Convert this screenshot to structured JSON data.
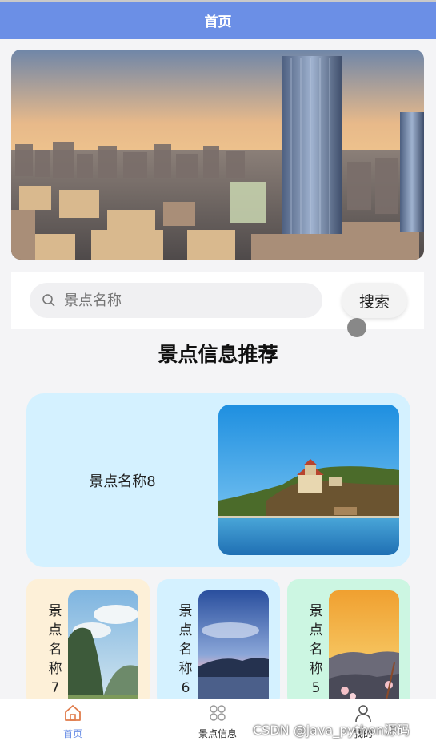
{
  "header": {
    "title": "首页"
  },
  "search": {
    "placeholder": "景点名称",
    "button_label": "搜索"
  },
  "section": {
    "title": "景点信息推荐"
  },
  "featured": {
    "name": "景点名称8"
  },
  "cards": [
    {
      "name": "景点名称7",
      "bg": "#fdf0d8"
    },
    {
      "name": "景点名称6",
      "bg": "#d4f1ff"
    },
    {
      "name": "景点名称5",
      "bg": "#ccf6e2"
    }
  ],
  "nav": {
    "items": [
      {
        "label": "首页",
        "icon": "home-icon",
        "active": true
      },
      {
        "label": "景点信息",
        "icon": "grid-icon",
        "active": false
      },
      {
        "label": "我的",
        "icon": "user-icon",
        "active": false
      }
    ]
  },
  "watermark": "CSDN @java_python源码",
  "colors": {
    "header": "#6b8fe6",
    "active_nav": "#6b8fe6"
  }
}
